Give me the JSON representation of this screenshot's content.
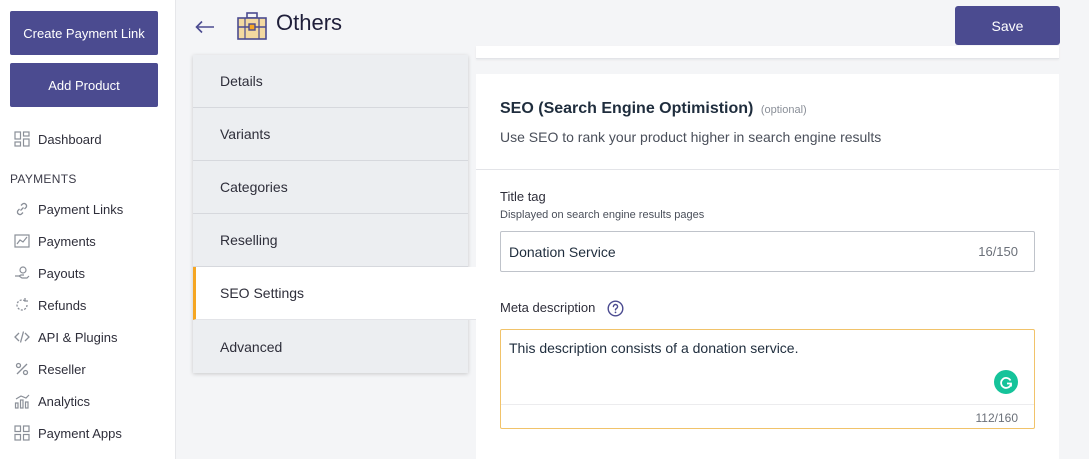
{
  "sidebar": {
    "create_link_label": "Create Payment Link",
    "add_product_label": "Add Product",
    "dashboard_label": "Dashboard",
    "section_payments": "PAYMENTS",
    "items": [
      {
        "label": "Payment Links",
        "icon": "link-icon"
      },
      {
        "label": "Payments",
        "icon": "chart-line-icon"
      },
      {
        "label": "Payouts",
        "icon": "hand-coin-icon"
      },
      {
        "label": "Refunds",
        "icon": "refresh-icon"
      },
      {
        "label": "API & Plugins",
        "icon": "code-icon"
      },
      {
        "label": "Reseller",
        "icon": "percent-icon"
      },
      {
        "label": "Analytics",
        "icon": "analytics-icon"
      },
      {
        "label": "Payment Apps",
        "icon": "apps-grid-icon"
      }
    ]
  },
  "header": {
    "title": "Others",
    "save_label": "Save"
  },
  "tabs": [
    {
      "label": "Details"
    },
    {
      "label": "Variants"
    },
    {
      "label": "Categories"
    },
    {
      "label": "Reselling"
    },
    {
      "label": "SEO Settings",
      "active": true
    },
    {
      "label": "Advanced"
    }
  ],
  "seo": {
    "title": "SEO (Search Engine Optimistion)",
    "optional": "(optional)",
    "subtitle": "Use SEO to rank your product higher in search engine results",
    "title_tag_label": "Title tag",
    "title_tag_help": "Displayed on search engine results pages",
    "title_tag_value": "Donation Service",
    "title_tag_count": "16/150",
    "meta_label": "Meta description",
    "meta_value": "This description consists of a donation service.",
    "meta_count": "112/160"
  },
  "colors": {
    "primary": "#4b4b90",
    "active_tab_accent": "#f5a623",
    "grammarly": "#15c39a"
  }
}
